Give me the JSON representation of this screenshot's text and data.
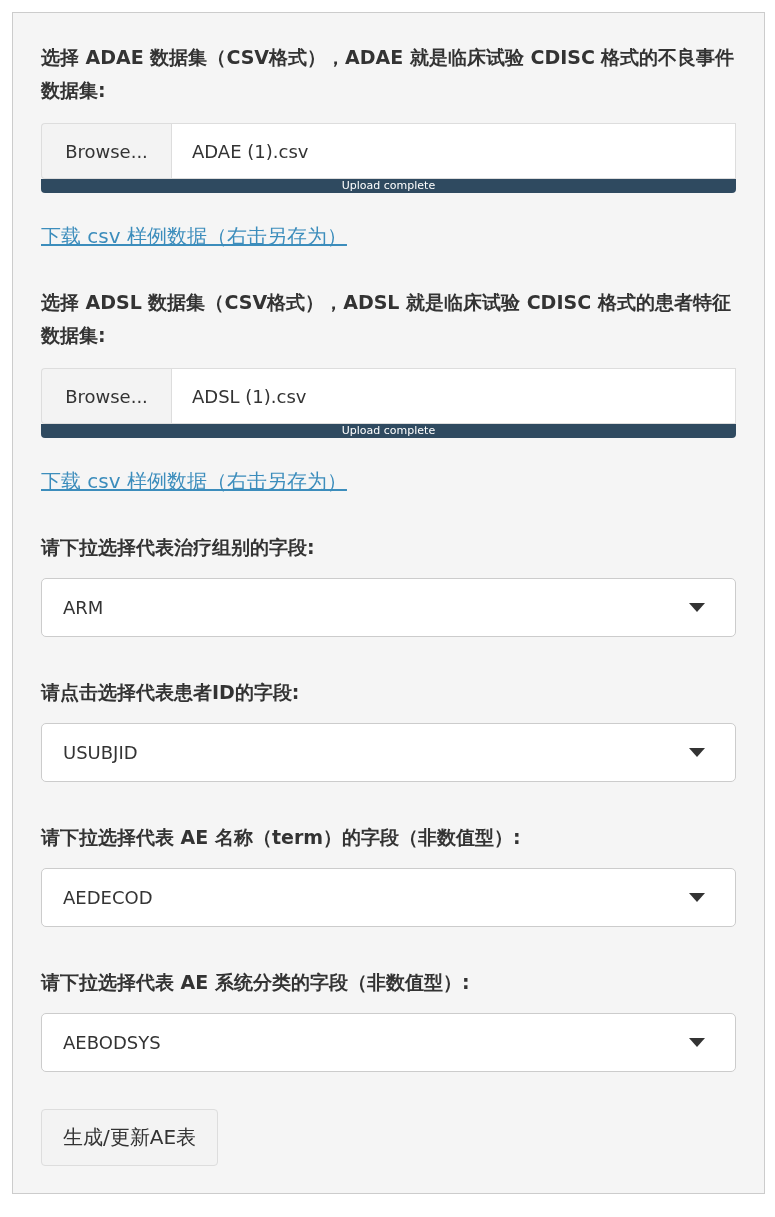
{
  "uploads": [
    {
      "label": "选择 ADAE 数据集（CSV格式），ADAE 就是临床试验 CDISC 格式的不良事件数据集:",
      "button": "Browse...",
      "filename": "ADAE (1).csv",
      "progress": {
        "level": 1,
        "text": "Upload complete"
      },
      "link": "下载 csv 样例数据（右击另存为）"
    },
    {
      "label": "选择 ADSL 数据集（CSV格式），ADSL 就是临床试验 CDISC 格式的患者特征数据集:",
      "button": "Browse...",
      "filename": "ADSL (1).csv",
      "progress": {
        "level": 1,
        "text": "Upload complete"
      },
      "link": "下载 csv 样例数据（右击另存为）"
    }
  ],
  "selects": [
    {
      "label": "请下拉选择代表治疗组别的字段:",
      "value": "ARM"
    },
    {
      "label": "请点击选择代表患者ID的字段:",
      "value": "USUBJID"
    },
    {
      "label": "请下拉选择代表 AE 名称（term）的字段（非数值型）:",
      "value": "AEDECOD"
    },
    {
      "label": "请下拉选择代表 AE 系统分类的字段（非数值型）:",
      "value": "AEBODSYS"
    }
  ],
  "button": "生成/更新AE表"
}
